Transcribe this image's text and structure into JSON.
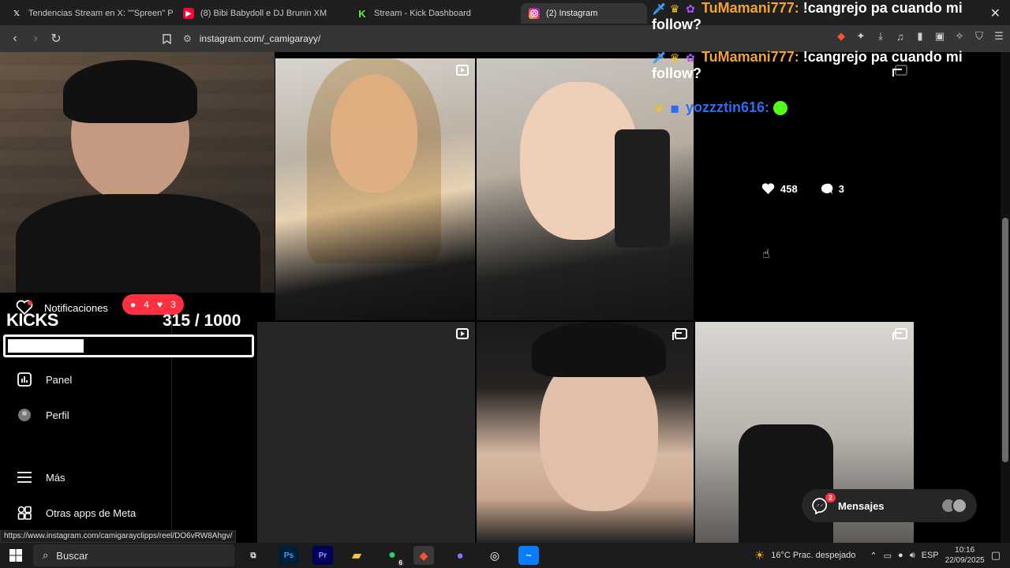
{
  "browser": {
    "tabs": [
      {
        "label": "Tendencias Stream en X: \"\"Spreen\" P",
        "icon": "x-logo-icon"
      },
      {
        "label": "(8) Bibi Babydoll e DJ Brunin XM",
        "icon": "youtube-icon"
      },
      {
        "label": "Stream - Kick Dashboard",
        "icon": "kick-logo-icon"
      },
      {
        "label": "(2) Instagram",
        "icon": "instagram-icon"
      }
    ],
    "url": "instagram.com/_camigarayy/",
    "status_url": "https://www.instagram.com/camigarayclipps/reel/DO6vRW8Ahgv/"
  },
  "instagram": {
    "sidebar": {
      "notifications": "Notificaciones",
      "panel": "Panel",
      "profile": "Perfil",
      "more": "Más",
      "meta_apps": "Otras apps de Meta"
    },
    "hover_stats": {
      "likes": "458",
      "comments": "3"
    },
    "messages": {
      "label": "Mensajes",
      "badge": "2"
    }
  },
  "overlay": {
    "notif_pill": {
      "comments": "4",
      "likes": "3"
    },
    "kicks": {
      "label": "KICKS",
      "current": "315",
      "goal": "/ 1000",
      "progress_fraction": 0.315
    },
    "chat": [
      {
        "user": "TuMamani777:",
        "text": " !cangrejo pa cuando mi",
        "cont": "follow?"
      },
      {
        "user": "TuMamani777:",
        "text": " !cangrejo pa cuando mi",
        "cont": "follow?"
      },
      {
        "user": "yozzztin616:",
        "text": "",
        "cont": ""
      }
    ]
  },
  "taskbar": {
    "search_placeholder": "Buscar",
    "weather": "16°C  Prac. despejado",
    "lang": "ESP",
    "time": "10:16",
    "date": "22/09/2025",
    "whatsapp_badge": "6"
  },
  "colors": {
    "instagram_red": "#ff3040",
    "chat_orange": "#f2a430",
    "chat_blue": "#2c6ef2"
  }
}
